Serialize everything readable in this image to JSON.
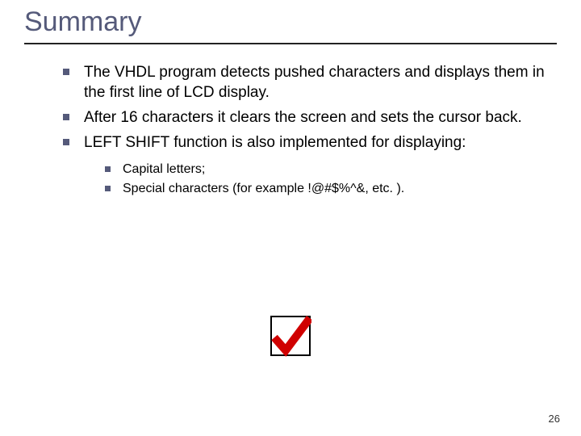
{
  "title": "Summary",
  "bullets": [
    "The VHDL program detects pushed characters and displays them in the first line of LCD display.",
    "After 16 characters it clears the screen and sets the cursor back.",
    "LEFT SHIFT function is also implemented for displaying:"
  ],
  "sub_bullets": [
    "Capital letters;",
    "Special characters (for example !@#$%^&, etc. )."
  ],
  "page_number": "26"
}
